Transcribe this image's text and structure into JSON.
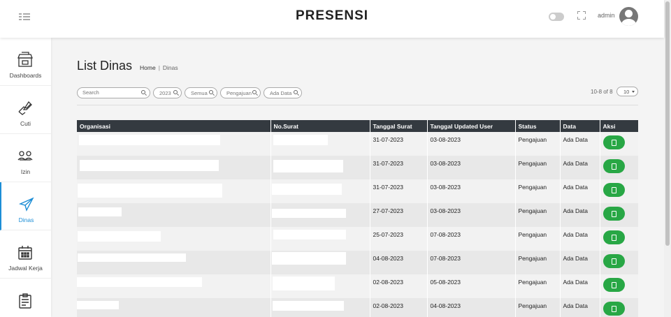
{
  "header": {
    "title": "PRESENSI",
    "user": "admin"
  },
  "sidebar": {
    "items": [
      {
        "label": "Dashboards",
        "icon": "store-icon"
      },
      {
        "label": "Cuti",
        "icon": "pencil-hand-icon"
      },
      {
        "label": "Izin",
        "icon": "hands-icon"
      },
      {
        "label": "Dinas",
        "icon": "airplane-icon",
        "active": true
      },
      {
        "label": "Jadwal Kerja",
        "icon": "calendar-icon"
      },
      {
        "label": "",
        "icon": "clipboard-icon"
      }
    ]
  },
  "page": {
    "title": "List Dinas",
    "breadcrumb": {
      "home": "Home",
      "separator": "|",
      "current": "Dinas"
    }
  },
  "filters": {
    "search_placeholder": "Search",
    "year": "2023",
    "organisasi": "Semua",
    "status": "Pengajuan",
    "data": "Ada Data"
  },
  "pagination": {
    "count": "10-8 of 8",
    "page_size": "10"
  },
  "table": {
    "headers": [
      "Organisasi",
      "No.Surat",
      "Tanggal Surat",
      "Tanggal Updated User",
      "Status",
      "Data",
      "Aksi"
    ],
    "rows": [
      {
        "tanggal_surat": "31-07-2023",
        "tanggal_updated": "03-08-2023",
        "status": "Pengajuan",
        "data": "Ada Data"
      },
      {
        "tanggal_surat": "31-07-2023",
        "tanggal_updated": "03-08-2023",
        "status": "Pengajuan",
        "data": "Ada Data"
      },
      {
        "tanggal_surat": "31-07-2023",
        "tanggal_updated": "03-08-2023",
        "status": "Pengajuan",
        "data": "Ada Data"
      },
      {
        "tanggal_surat": "27-07-2023",
        "tanggal_updated": "03-08-2023",
        "status": "Pengajuan",
        "data": "Ada Data"
      },
      {
        "tanggal_surat": "25-07-2023",
        "tanggal_updated": "07-08-2023",
        "status": "Pengajuan",
        "data": "Ada Data"
      },
      {
        "tanggal_surat": "04-08-2023",
        "tanggal_updated": "07-08-2023",
        "status": "Pengajuan",
        "data": "Ada Data"
      },
      {
        "tanggal_surat": "02-08-2023",
        "tanggal_updated": "05-08-2023",
        "status": "Pengajuan",
        "data": "Ada Data"
      },
      {
        "tanggal_surat": "02-08-2023",
        "tanggal_updated": "04-08-2023",
        "status": "Pengajuan",
        "data": "Ada Data"
      }
    ]
  },
  "colors": {
    "accent": "#1d8ed6",
    "action_button": "#28a745",
    "table_header": "#343a40"
  }
}
